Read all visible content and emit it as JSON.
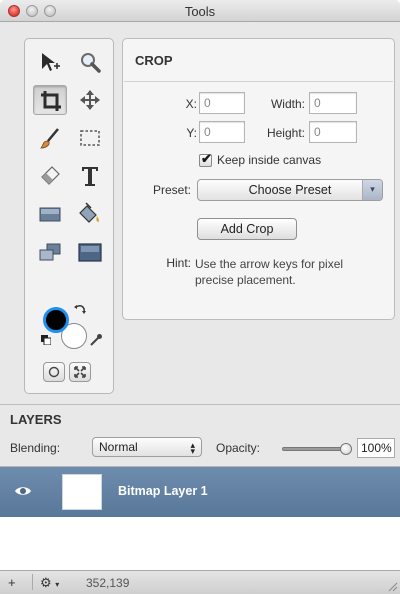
{
  "window": {
    "title": "Tools"
  },
  "tools": [
    {
      "name": "move-selection-tool",
      "active": false
    },
    {
      "name": "zoom-tool",
      "active": false
    },
    {
      "name": "crop-tool",
      "active": true
    },
    {
      "name": "pan-tool",
      "active": false
    },
    {
      "name": "brush-tool",
      "active": false
    },
    {
      "name": "rect-select-tool",
      "active": false
    },
    {
      "name": "eraser-tool",
      "active": false
    },
    {
      "name": "text-tool",
      "active": false
    },
    {
      "name": "rectangle-shape-tool",
      "active": false
    },
    {
      "name": "fill-tool",
      "active": false
    },
    {
      "name": "layer-tool",
      "active": false
    },
    {
      "name": "image-tool",
      "active": false
    }
  ],
  "colors": {
    "foreground": "#000000",
    "background": "#ffffff",
    "selection_accent": "#1f8ff0",
    "layer_highlight": "#6482a4"
  },
  "crop_panel": {
    "title": "CROP",
    "x_label": "X:",
    "x_value": "0",
    "width_label": "Width:",
    "width_value": "0",
    "y_label": "Y:",
    "y_value": "0",
    "height_label": "Height:",
    "height_value": "0",
    "keep_inside_label": "Keep inside canvas",
    "keep_inside_checked": true,
    "preset_label": "Preset:",
    "preset_value": "Choose Preset",
    "add_crop_label": "Add Crop",
    "hint_label": "Hint:",
    "hint_line1": "Use the arrow keys for pixel",
    "hint_line2": "precise placement."
  },
  "layers": {
    "title": "LAYERS",
    "blending_label": "Blending:",
    "blending_value": "Normal",
    "opacity_label": "Opacity:",
    "opacity_value": "100%",
    "opacity_fraction": 1.0,
    "items": [
      {
        "name": "Bitmap Layer 1",
        "visible": true,
        "selected": true
      }
    ]
  },
  "statusbar": {
    "add_label": "+",
    "gear_label": "⚙",
    "coords": "352,139"
  }
}
